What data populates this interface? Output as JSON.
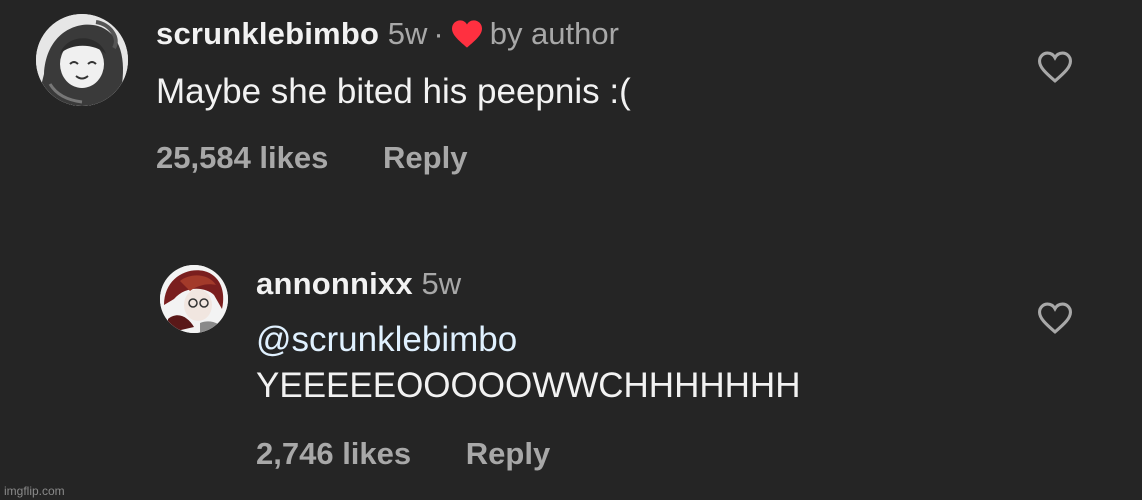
{
  "comments": [
    {
      "username": "scrunklebimbo",
      "age": "5w",
      "separator": "·",
      "author_badge": "by author",
      "text": "Maybe she bited his peepnis :(",
      "likes": "25,584 likes",
      "reply_label": "Reply"
    },
    {
      "username": "annonnixx",
      "age": "5w",
      "mention": "@scrunklebimbo",
      "text": "YEEEEEOOOOOWWCHHHHHHH",
      "likes": "2,746 likes",
      "reply_label": "Reply"
    }
  ],
  "watermark": "imgflip.com",
  "icons": {
    "author_heart": "heart-filled-icon",
    "like_button": "heart-outline-icon"
  },
  "colors": {
    "background": "#252525",
    "author_heart": "#ff3040",
    "secondary_text": "#a8a8a8",
    "mention": "#e0f1ff"
  }
}
